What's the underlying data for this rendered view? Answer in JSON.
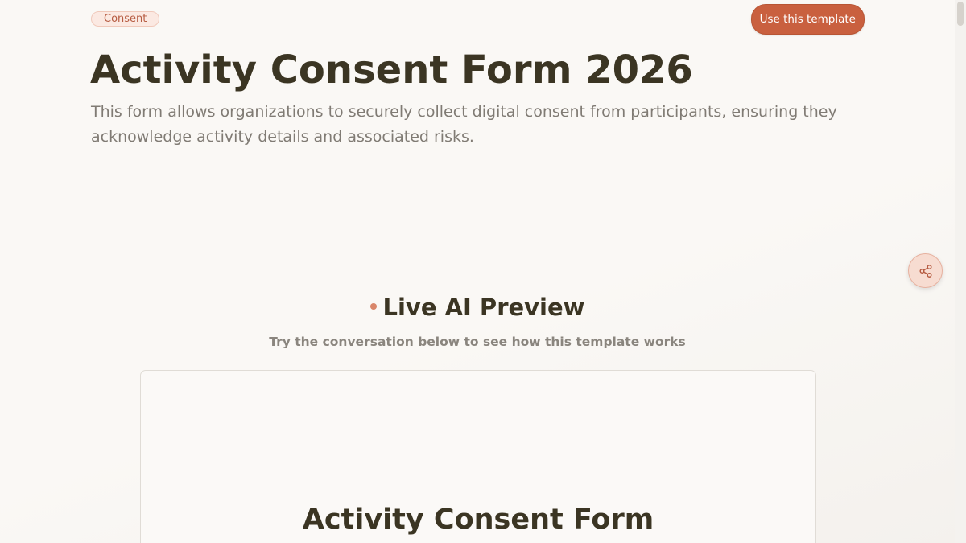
{
  "header": {
    "tag_label": "Consent",
    "cta_label": "Use this template"
  },
  "hero": {
    "title": "Activity Consent Form 2026",
    "description": "This form allows organizations to securely collect digital consent from participants, ensuring they acknowledge activity details and associated risks."
  },
  "share": {
    "icon": "share-icon"
  },
  "preview": {
    "heading": "Live AI Preview",
    "subheading": "Try the conversation below to see how this template works",
    "form_title": "Activity Consent Form"
  },
  "colors": {
    "accent": "#c9603f",
    "title": "#3b3523",
    "muted": "#807b74"
  }
}
